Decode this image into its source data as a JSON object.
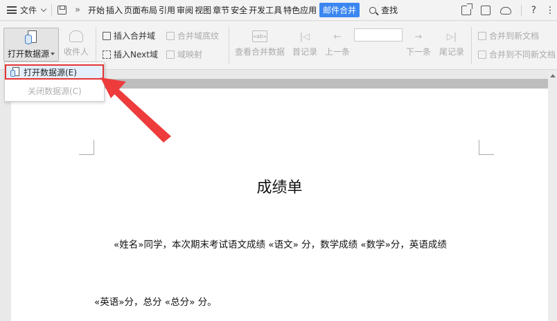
{
  "menubar": {
    "file_label": "文件",
    "more_symbol": "»",
    "tabs": [
      "开始",
      "插入",
      "页面布局",
      "引用",
      "审阅",
      "视图",
      "章节",
      "安全",
      "开发工具",
      "特色应用"
    ],
    "active_tab": "邮件合并",
    "search_label": "查找",
    "help_symbol": "?"
  },
  "ribbon": {
    "open_source": "打开数据源",
    "recipients": "收件人",
    "insert_merge_field": "插入合并域",
    "merge_field_shading": "合并域底纹",
    "insert_next_field": "插入Next域",
    "field_mapping": "域映射",
    "view_merged_data": "查看合并数据",
    "view_icon_text": "«ab»",
    "first_record": "首记录",
    "prev_record": "上一条",
    "next_record": "下一条",
    "last_record": "尾记录",
    "merge_new_doc": "合并到新文档",
    "merge_different_docs": "合并到不同新文档"
  },
  "dropdown": {
    "open_item": "打开数据源(E)",
    "close_item": "关闭数据源(C)"
  },
  "document": {
    "title": "成绩单",
    "line1": "«姓名»同学，本次期末考试语文成绩 «语文» 分，数学成绩 «数学»分，英语成绩",
    "line2": "«英语»分，总分 «总分» 分。"
  },
  "colors": {
    "accent": "#3b86f0",
    "highlight_border": "#e53333",
    "arrow": "#ee3b3b"
  }
}
